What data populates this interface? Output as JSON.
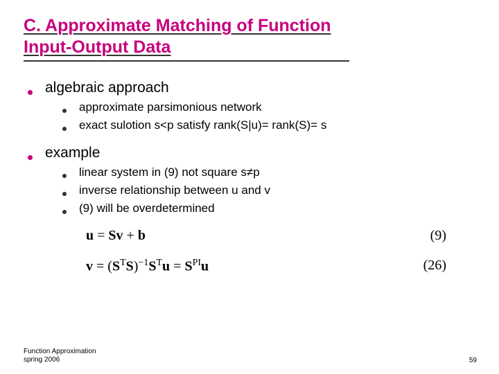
{
  "title": "C. Approximate Matching of Function Input-Output Data",
  "section1": {
    "heading": "algebraic approach",
    "items": [
      "approximate parsimonious network",
      "exact sulotion s<p satisfy rank(S|u)= rank(S)= s"
    ]
  },
  "section2": {
    "heading": "example",
    "items": [
      "linear system in (9) not square s≠p",
      "inverse relationship between u and v",
      "(9) will be overdetermined"
    ]
  },
  "equations": {
    "eq1": {
      "lhs": "u",
      "rhs": "= Sv + b",
      "num": "(9)"
    },
    "eq2": {
      "full": "v = (SᵀS)⁻¹Sᵀu = Sᴾᴵu",
      "num": "(26)"
    }
  },
  "footer": {
    "line1": "Function Approximation",
    "line2": "spring 2006"
  },
  "pagenum": "59"
}
